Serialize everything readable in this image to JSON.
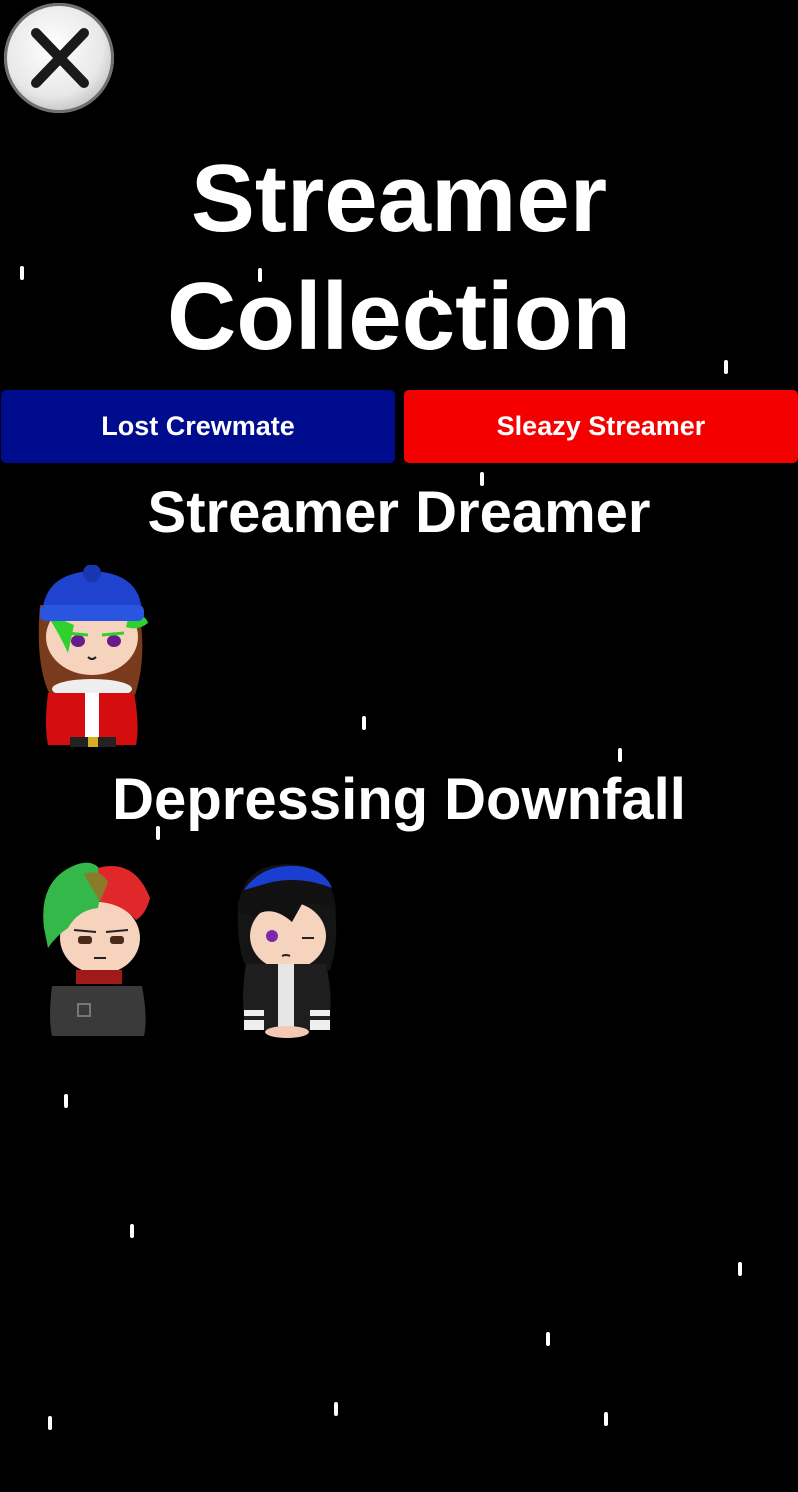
{
  "close_button": {
    "icon": "close-x-icon"
  },
  "title": "Streamer Collection",
  "tabs": [
    {
      "label": "Lost Crewmate",
      "color": "#000c8e"
    },
    {
      "label": "Sleazy Streamer",
      "color": "#f50000"
    }
  ],
  "sections": [
    {
      "title": "Streamer Dreamer",
      "characters": [
        "winter-hat-character"
      ]
    },
    {
      "title": "Depressing Downfall",
      "characters": [
        "green-red-hair-character",
        "black-blue-hair-character"
      ]
    }
  ],
  "colors": {
    "background": "#000000",
    "text": "#ffffff"
  }
}
